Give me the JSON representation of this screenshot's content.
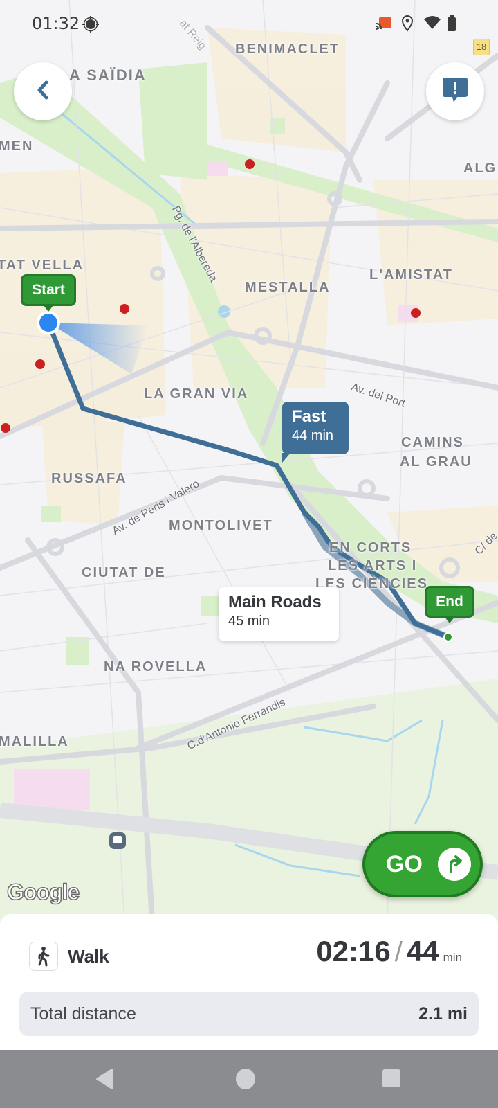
{
  "status_bar": {
    "time": "01:32",
    "icons": [
      "gps-icon",
      "cast-icon",
      "location-icon",
      "wifi-icon",
      "battery-icon"
    ]
  },
  "map": {
    "route_badge": "18",
    "neighborhoods": [
      "BENIMACLET",
      "A SAÏDIA",
      "MEN",
      "ALG",
      "TAT VELLA",
      "MESTALLA",
      "L'AMISTAT",
      "LA GRAN VIA",
      "CAMINS",
      "AL GRAU",
      "RUSSAFA",
      "MONTOLIVET",
      "EN CORTS",
      "CIUTAT DE",
      "LES ARTS I",
      "LES CIÈNCIES",
      "NA ROVELLA",
      "MALILLA"
    ],
    "streets": [
      "Pg. de l'Albereda",
      "Av. del Port",
      "Av. de Peris i Valero",
      "C.d'Antonio Ferrandis",
      "C/ de",
      "at Reig"
    ],
    "start_label": "Start",
    "end_label": "End",
    "routes": [
      {
        "name": "Fast",
        "duration": "44 min",
        "selected": true,
        "color": "#3f6f96"
      },
      {
        "name": "Main Roads",
        "duration": "45 min",
        "selected": false,
        "color": "#ffffff"
      }
    ],
    "attribution": "Google",
    "go_label": "GO"
  },
  "panel": {
    "mode_label": "Walk",
    "elapsed": "02:16",
    "separator": "/",
    "total": "44",
    "unit": "min",
    "distance_label": "Total distance",
    "distance_value": "2.1 mi"
  },
  "colors": {
    "accent_green": "#34a532",
    "route_blue": "#3f6f96"
  }
}
